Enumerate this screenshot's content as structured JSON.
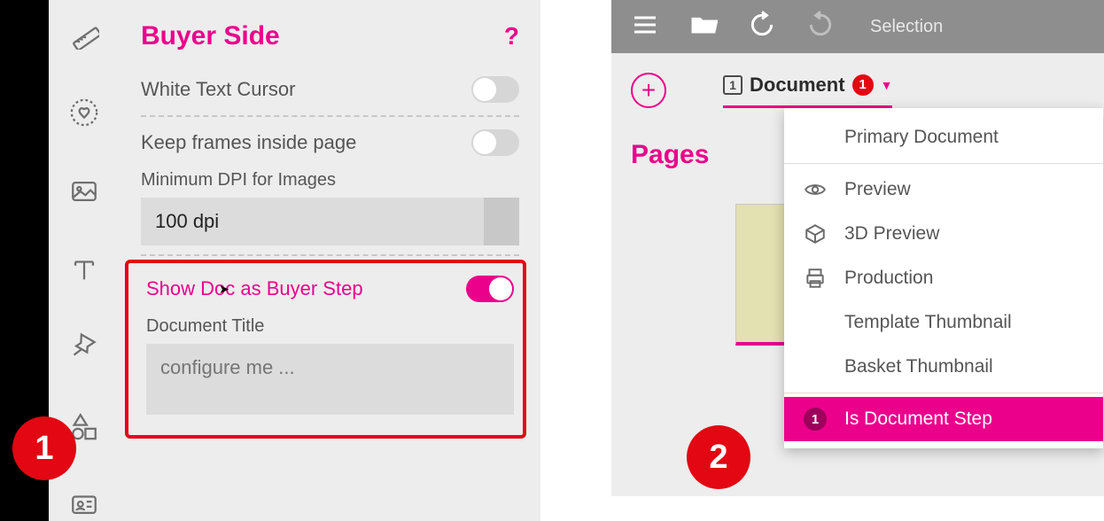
{
  "leftPanel": {
    "title": "Buyer Side",
    "helpIcon": "?",
    "rows": {
      "whiteTextCursor": {
        "label": "White Text Cursor",
        "on": false
      },
      "keepFrames": {
        "label": "Keep frames inside page",
        "on": false
      }
    },
    "minDpi": {
      "label": "Minimum DPI for Images",
      "value": "100 dpi"
    },
    "showDoc": {
      "label": "Show Doc as Buyer Step",
      "on": true,
      "titleLabel": "Document Title",
      "titlePlaceholder": "configure me ..."
    }
  },
  "badges": {
    "one": "1",
    "two": "2"
  },
  "rightPanel": {
    "topbar": {
      "selection": "Selection"
    },
    "docTab": {
      "num": "1",
      "title": "Document",
      "badge": "1",
      "caret": "▼"
    },
    "pagesHeader": "Pages",
    "dropdown": [
      {
        "label": "Primary Document",
        "icon": ""
      },
      {
        "label": "Preview",
        "icon": "eye"
      },
      {
        "label": "3D Preview",
        "icon": "cube"
      },
      {
        "label": "Production",
        "icon": "printer"
      },
      {
        "label": "Template Thumbnail",
        "icon": ""
      },
      {
        "label": "Basket Thumbnail",
        "icon": ""
      }
    ],
    "selectedItem": {
      "num": "1",
      "label": "Is Document Step"
    }
  },
  "toolbar": {
    "icons": [
      "ruler",
      "heart-badge",
      "image",
      "text",
      "pin",
      "shapes",
      "id-card"
    ]
  }
}
